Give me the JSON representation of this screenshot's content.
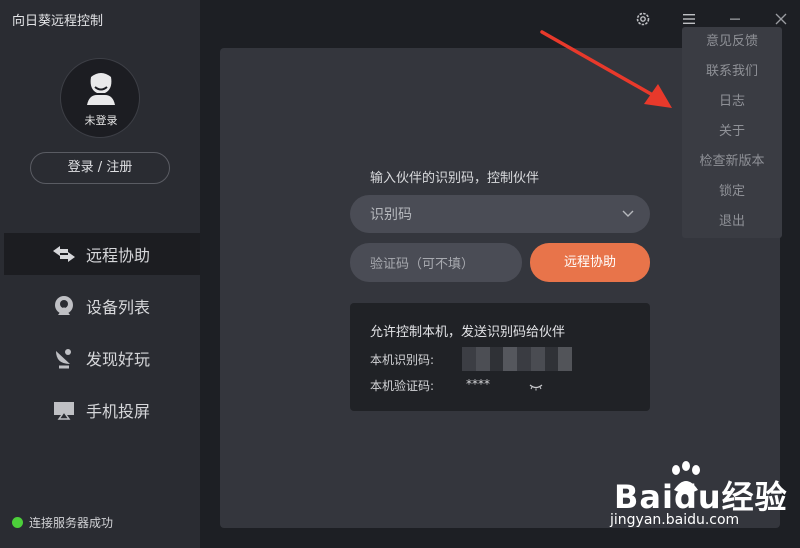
{
  "app": {
    "title": "向日葵远程控制"
  },
  "account": {
    "avatar_label": "未登录",
    "login_label": "登录 / 注册"
  },
  "nav": {
    "items": [
      {
        "label": "远程协助",
        "icon": "swap-arrows-icon",
        "active": true
      },
      {
        "label": "设备列表",
        "icon": "device-pin-icon",
        "active": false
      },
      {
        "label": "发现好玩",
        "icon": "satellite-icon",
        "active": false
      },
      {
        "label": "手机投屏",
        "icon": "screen-cast-icon",
        "active": false
      }
    ]
  },
  "status": {
    "text": "连接服务器成功",
    "color": "#4ccf3a"
  },
  "remote": {
    "prompt": "输入伙伴的识别码，控制伙伴",
    "id_placeholder": "识别码",
    "code_placeholder": "验证码（可不填）",
    "connect_label": "远程协助"
  },
  "local": {
    "title": "允许控制本机，发送识别码给伙伴",
    "id_label": "本机识别码:",
    "code_label": "本机验证码:",
    "code_value": "****"
  },
  "menu": {
    "items": [
      "意见反馈",
      "联系我们",
      "日志",
      "关于",
      "检查新版本",
      "锁定",
      "退出"
    ]
  },
  "watermark": {
    "brand": "Baidu经验",
    "url": "jingyan.baidu.com"
  },
  "colors": {
    "accent": "#e8744a",
    "arrow": "#e8392b"
  }
}
